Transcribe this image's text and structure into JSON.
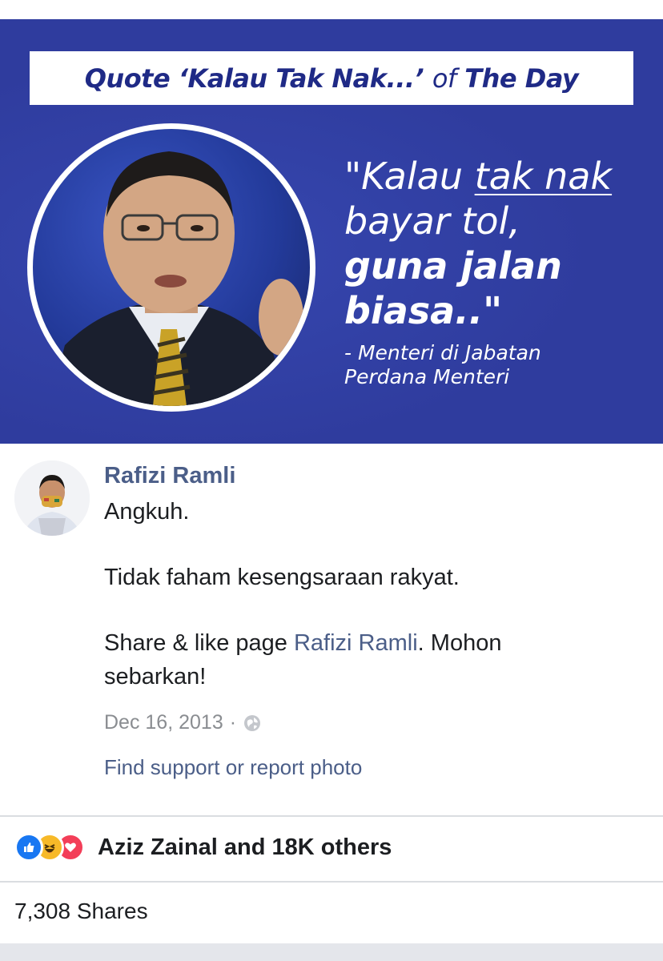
{
  "banner": {
    "title": {
      "part1": "Quote ‘Kalau Tak Nak...’",
      "part2": "of",
      "part3": "The Day"
    },
    "quote": {
      "line1_a": "\"Kalau ",
      "line1_b": "tak nak",
      "line2": "bayar tol,",
      "line3": "guna jalan",
      "line4": "biasa..\""
    },
    "attribution": {
      "line1": "- Menteri di Jabatan",
      "line2": "Perdana Menteri"
    },
    "colors": {
      "background": "#2f3c9e",
      "title_text": "#1f2a86"
    }
  },
  "post": {
    "author": "Rafizi Ramli",
    "paragraph1": "Angkuh.",
    "paragraph2": "Tidak faham kesengsaraan rakyat.",
    "paragraph3_prefix": "Share & like page ",
    "paragraph3_mention": "Rafizi Ramli",
    "paragraph3_suffix": ". Mohon",
    "paragraph3_line2": "sebarkan!",
    "date": "Dec 16, 2013",
    "separator": "·",
    "privacy_icon": "globe-icon",
    "report_link": "Find support or report photo"
  },
  "engagement": {
    "reaction_icons": [
      "like-icon",
      "haha-icon",
      "love-icon"
    ],
    "reactions_text": "Aziz Zainal and 18K others",
    "shares_text": "7,308 Shares"
  }
}
